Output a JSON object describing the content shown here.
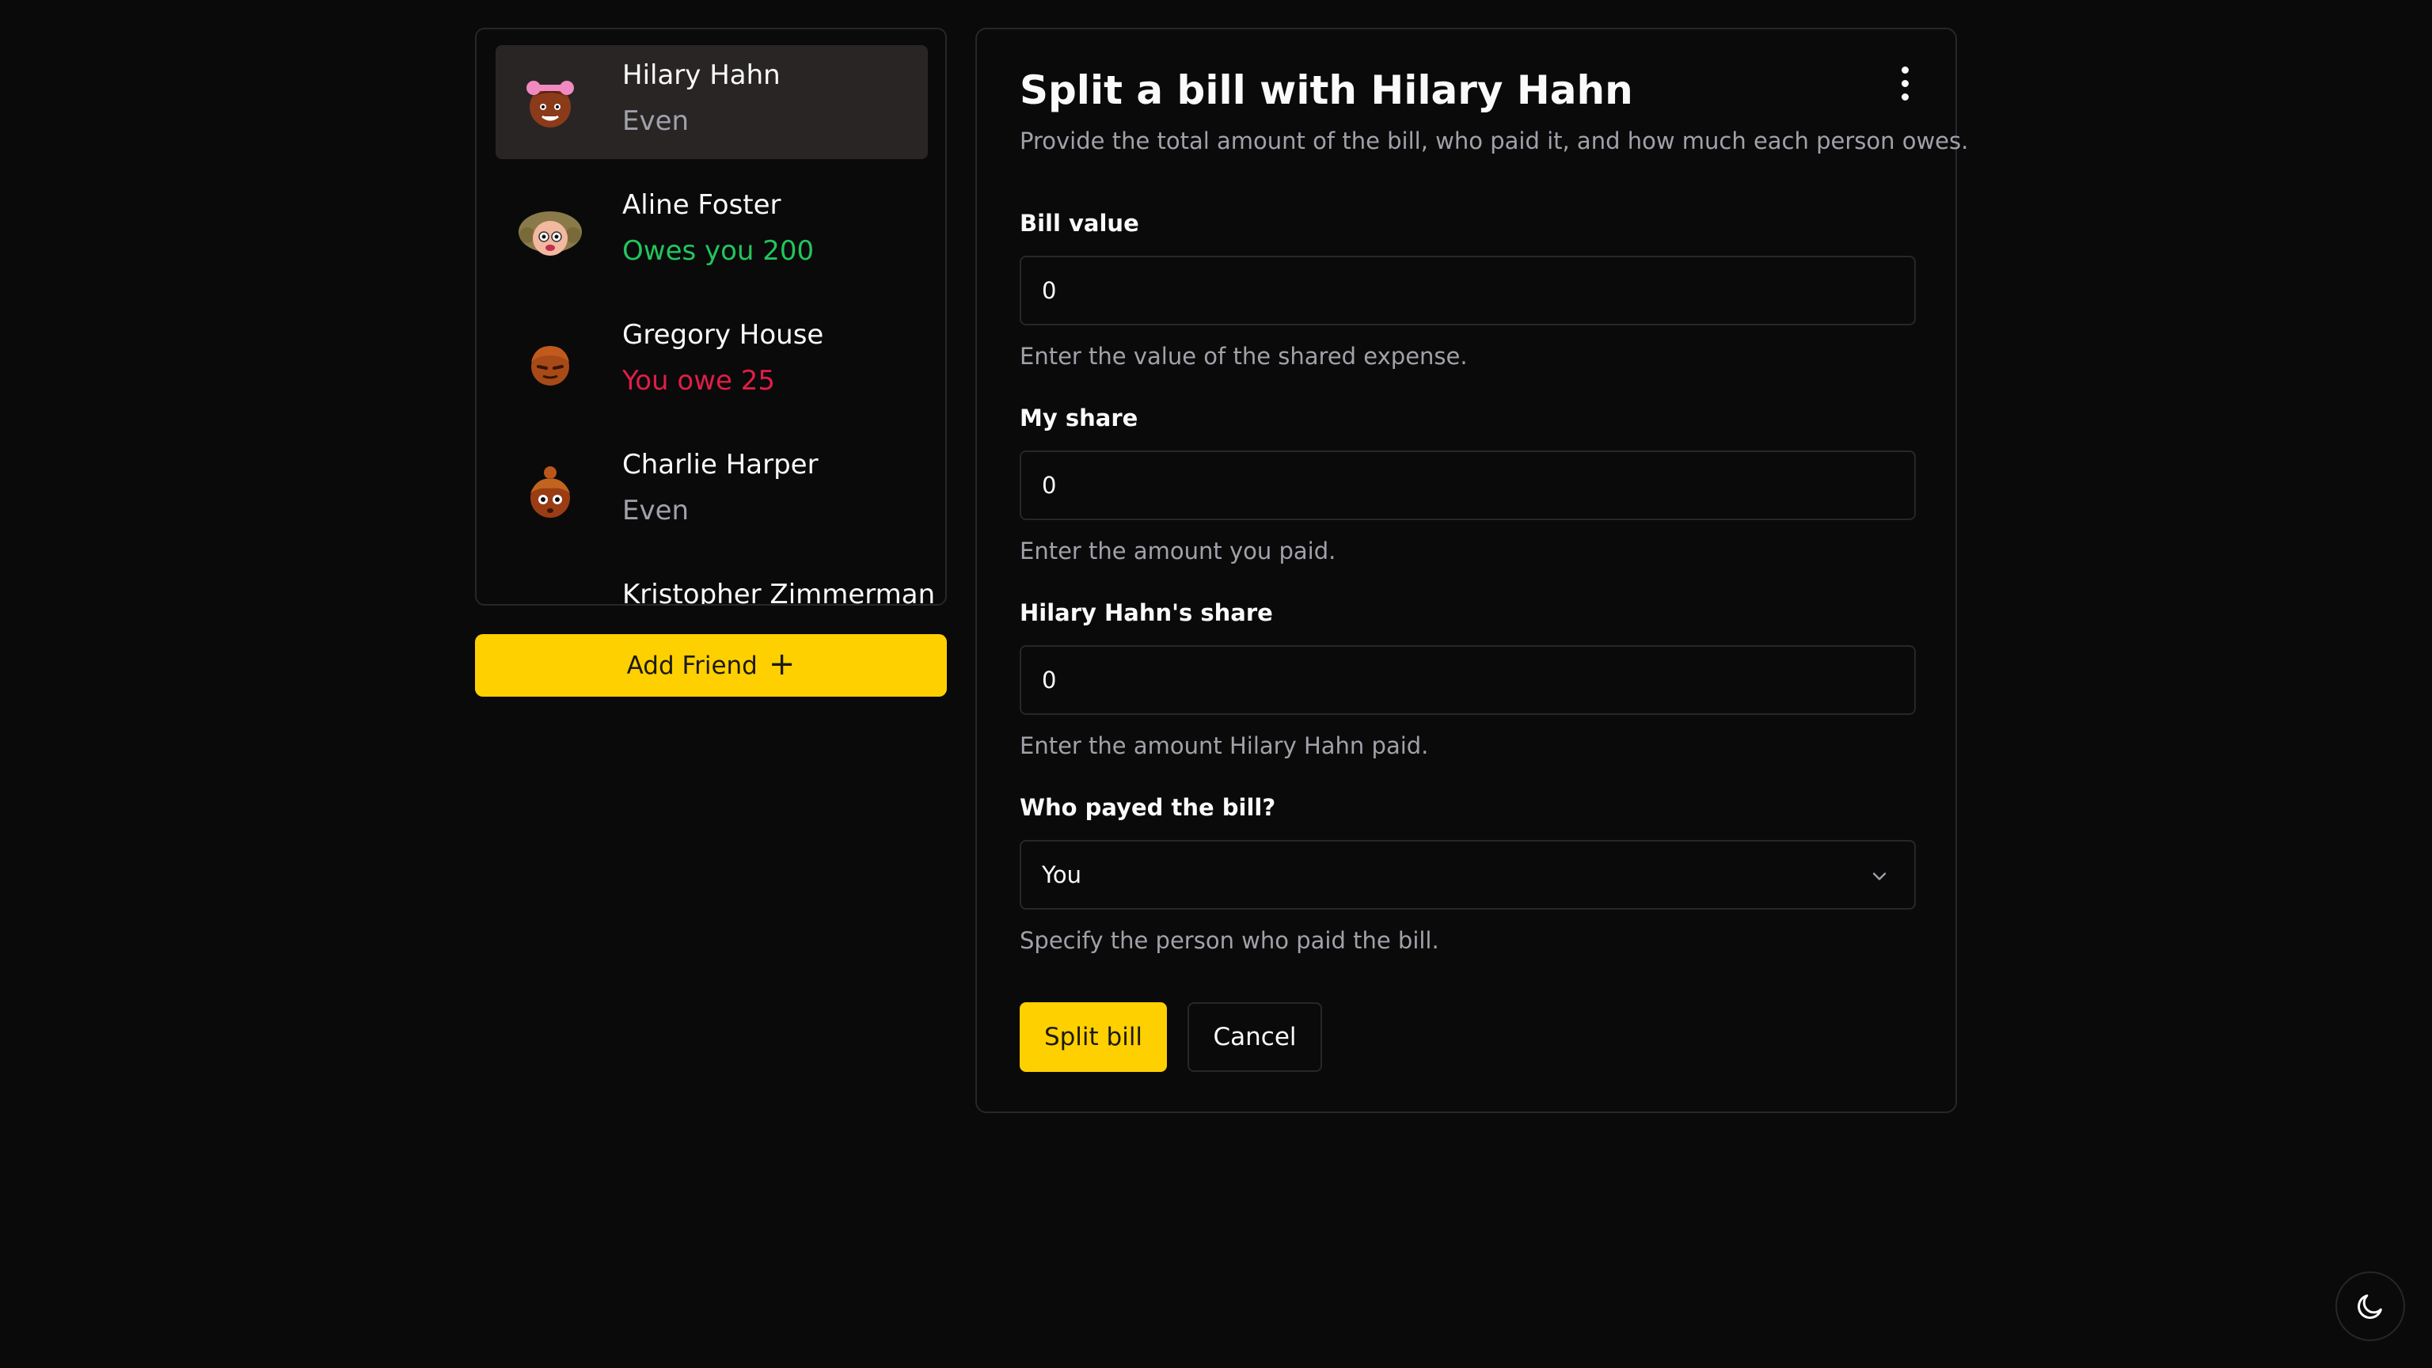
{
  "friends": [
    {
      "name": "Hilary Hahn",
      "balance": "Even",
      "status": "even",
      "active": true
    },
    {
      "name": "Aline Foster",
      "balance": "Owes you 200",
      "status": "owed"
    },
    {
      "name": "Gregory House",
      "balance": "You owe 25",
      "status": "owe"
    },
    {
      "name": "Charlie Harper",
      "balance": "Even",
      "status": "even"
    },
    {
      "name": "Kristopher Zimmerman",
      "balance": "",
      "status": "even"
    }
  ],
  "add_friend": {
    "label": "Add Friend",
    "icon": "plus-icon"
  },
  "split_form": {
    "title": "Split a bill with Hilary Hahn",
    "description": "Provide the total amount of the bill, who paid it, and how much each person owes.",
    "bill_value": {
      "label": "Bill value",
      "value": "0",
      "hint": "Enter the value of the shared expense."
    },
    "my_share": {
      "label": "My share",
      "value": "0",
      "hint": "Enter the amount you paid."
    },
    "friend_share": {
      "label": "Hilary Hahn's share",
      "value": "0",
      "hint": "Enter the amount Hilary Hahn paid."
    },
    "payer": {
      "label": "Who payed the bill?",
      "selected": "You",
      "hint": "Specify the person who paid the bill."
    },
    "submit_label": "Split bill",
    "cancel_label": "Cancel",
    "menu_icon": "more-vertical-icon"
  },
  "theme_toggle": {
    "icon": "moon-icon"
  },
  "colors": {
    "accent": "#ffd000",
    "background": "#0a0a0a",
    "border": "#27272a",
    "positive": "#22c55e",
    "negative": "#e11d48",
    "muted": "#a1a1aa"
  }
}
